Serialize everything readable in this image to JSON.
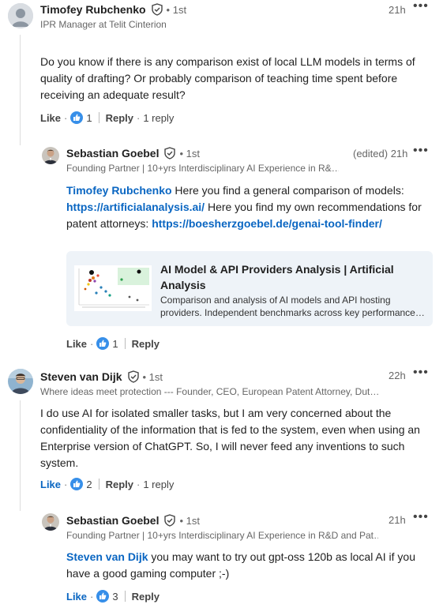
{
  "comments": [
    {
      "name": "Timofey Rubchenko",
      "degree": "• 1st",
      "headline": "IPR Manager at Telit Cinterion",
      "time": "21h",
      "text": "Do you know if there is any comparison exist of local LLM models in terms of quality of drafting? Or probably comparison of teaching time spent before receiving an adequate result?",
      "like_label": "Like",
      "like_count": "1",
      "reply_label": "Reply",
      "replies_label": "1 reply"
    },
    {
      "name": "Sebastian Goebel",
      "degree": "• 1st",
      "headline": "Founding Partner | 10+yrs Interdisciplinary AI Experience in R&…",
      "time": "(edited) 21h",
      "mention": "Timofey Rubchenko",
      "text_a": " Here you find a general comparison of models: ",
      "link_a": "https://artificialanalysis.ai/",
      "text_b": " Here you find my own recommendations for patent attorneys: ",
      "link_b": "https://boesherzgoebel.de/genai-tool-finder/",
      "preview": {
        "title": "AI Model & API Providers Analysis | Artificial Analysis",
        "desc": "Comparison and analysis of AI models and API hosting providers. Independent benchmarks across key performance…"
      },
      "like_label": "Like",
      "like_count": "1",
      "reply_label": "Reply"
    },
    {
      "name": "Steven van Dijk",
      "degree": "• 1st",
      "headline": "Where ideas meet protection --- Founder, CEO, European Patent Attorney, Dut…",
      "time": "22h",
      "text": "I do use AI for isolated smaller tasks, but I am very concerned about the confidentiality of the information that is fed to the system, even when using an Enterprise version of ChatGPT. So, I will never feed any inventions to such system.",
      "like_label": "Like",
      "like_count": "2",
      "reply_label": "Reply",
      "replies_label": "1 reply"
    },
    {
      "name": "Sebastian Goebel",
      "degree": "• 1st",
      "headline": "Founding Partner | 10+yrs Interdisciplinary AI Experience in R&D and Pat…",
      "time": "21h",
      "mention": "Steven van Dijk",
      "text": " you may want to try out gpt-oss 120b as local AI if you have a good gaming computer ;-)",
      "like_label": "Like",
      "like_count": "3",
      "reply_label": "Reply"
    }
  ],
  "more_icon": "more-horizontal-icon",
  "colors": {
    "link": "#0a66c2",
    "like_blue": "#378fe9"
  }
}
